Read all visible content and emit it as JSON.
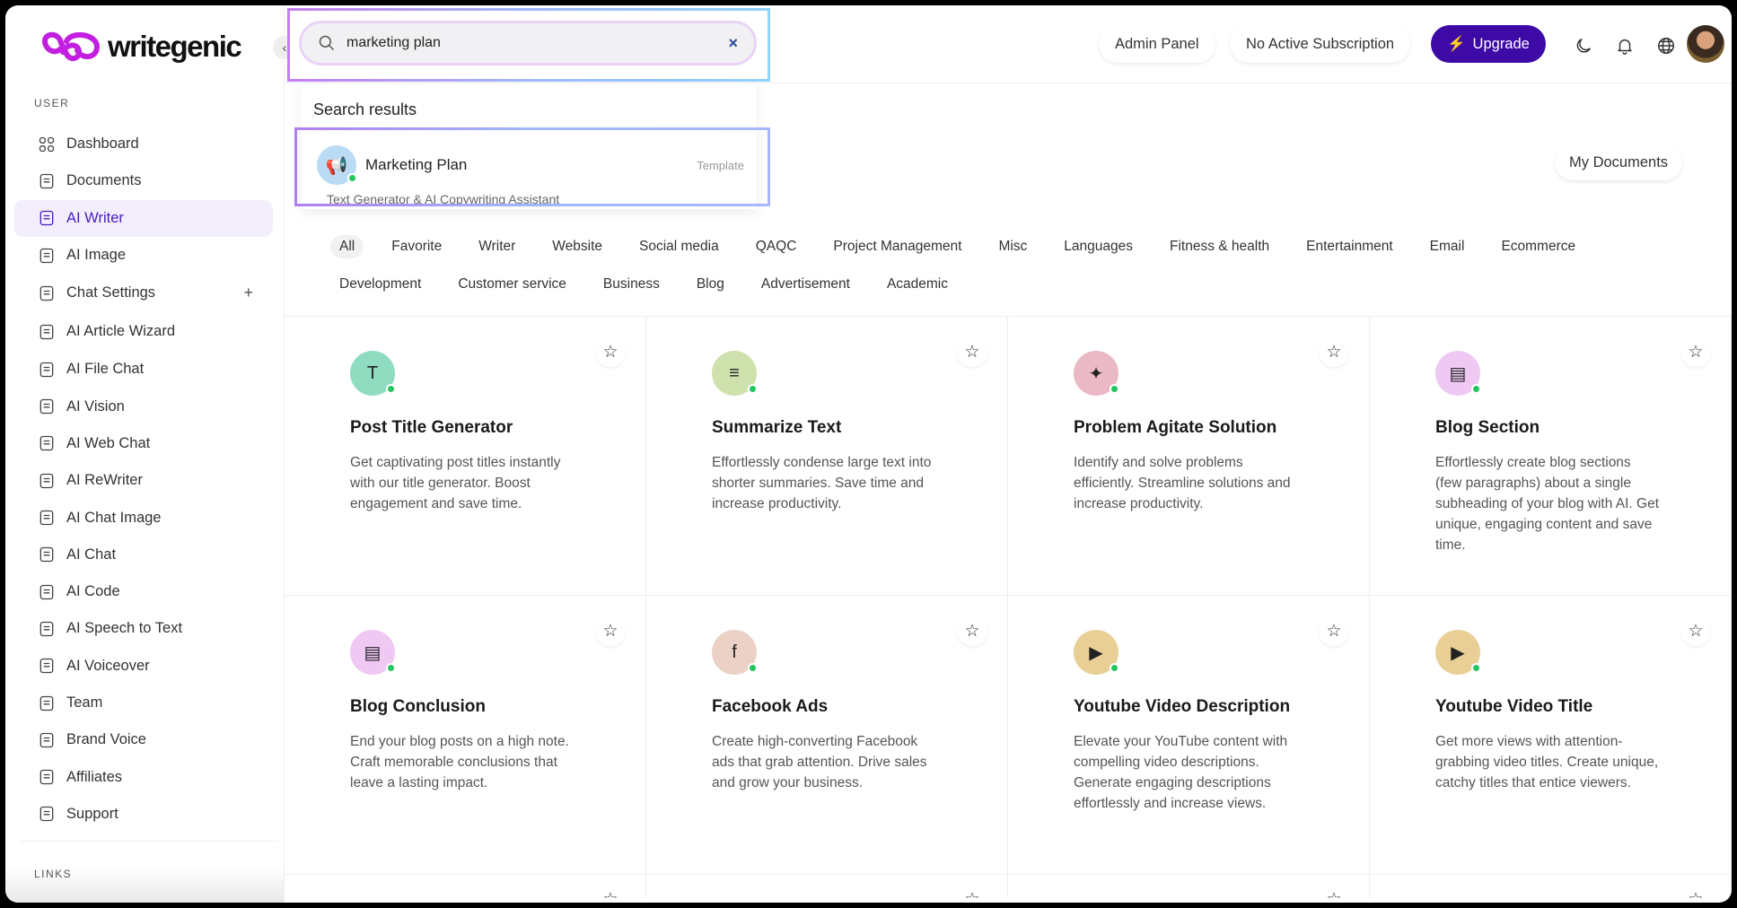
{
  "brand": {
    "name": "writegenic",
    "color": "#c21fe0"
  },
  "sidebar": {
    "section_user": "USER",
    "section_links": "LINKS",
    "active": "AI Writer",
    "items": [
      {
        "label": "Dashboard",
        "icon": "grid-icon"
      },
      {
        "label": "Documents",
        "icon": "archive-icon"
      },
      {
        "label": "AI Writer",
        "icon": "document-icon"
      },
      {
        "label": "AI Image",
        "icon": "image-icon"
      },
      {
        "label": "Chat Settings",
        "icon": "chat-bubble-icon"
      },
      {
        "label": "AI Article Wizard",
        "icon": "article-icon"
      },
      {
        "label": "AI File Chat",
        "icon": "file-icon"
      },
      {
        "label": "AI Vision",
        "icon": "scan-icon"
      },
      {
        "label": "AI Web Chat",
        "icon": "web-icon"
      },
      {
        "label": "AI ReWriter",
        "icon": "pen-icon"
      },
      {
        "label": "AI Chat Image",
        "icon": "image-icon"
      },
      {
        "label": "AI Chat",
        "icon": "chat-icon"
      },
      {
        "label": "AI Code",
        "icon": "terminal-icon"
      },
      {
        "label": "AI Speech to Text",
        "icon": "microphone-icon"
      },
      {
        "label": "AI Voiceover",
        "icon": "speaker-icon"
      },
      {
        "label": "Team",
        "icon": "user-plus-icon"
      },
      {
        "label": "Brand Voice",
        "icon": "brand-icon"
      },
      {
        "label": "Affiliates",
        "icon": "dollar-icon"
      },
      {
        "label": "Support",
        "icon": "lifebuoy-icon"
      }
    ]
  },
  "search": {
    "value": "marketing plan",
    "results_title": "Search results",
    "result": {
      "name": "Marketing Plan",
      "tag": "Template",
      "subtitle": "Text Generator & AI Copywriting Assistant"
    }
  },
  "topbar": {
    "admin_panel": "Admin Panel",
    "subscription": "No Active Subscription",
    "upgrade": "Upgrade",
    "accent": "#3d0aa6"
  },
  "my_documents": "My Documents",
  "filters": [
    "All",
    "Favorite",
    "Writer",
    "Website",
    "Social media",
    "QAQC",
    "Project Management",
    "Misc",
    "Languages",
    "Fitness & health",
    "Entertainment",
    "Email",
    "Ecommerce",
    "Development",
    "Customer service",
    "Business",
    "Blog",
    "Advertisement",
    "Academic"
  ],
  "selected_filter": "All",
  "cards": [
    {
      "title": "Post Title Generator",
      "desc": "Get captivating post titles instantly with our title generator. Boost engagement and save time.",
      "glyph": "T",
      "bg": "#8fdcc0"
    },
    {
      "title": "Summarize Text",
      "desc": "Effortlessly condense large text into shorter summaries. Save time and increase productivity.",
      "glyph": "≡",
      "bg": "#cfe1ad"
    },
    {
      "title": "Problem Agitate Solution",
      "desc": "Identify and solve problems efficiently. Streamline solutions and increase productivity.",
      "glyph": "✦",
      "bg": "#ebb9c6"
    },
    {
      "title": "Blog Section",
      "desc": "Effortlessly create blog sections (few paragraphs) about a single subheading of your blog with AI. Get unique, engaging content and save time.",
      "glyph": "▤",
      "bg": "#efc8f4"
    },
    {
      "title": "Blog Conclusion",
      "desc": "End your blog posts on a high note. Craft memorable conclusions that leave a lasting impact.",
      "glyph": "▤",
      "bg": "#efc8f4"
    },
    {
      "title": "Facebook Ads",
      "desc": "Create high-converting Facebook ads that grab attention. Drive sales and grow your business.",
      "glyph": "f",
      "bg": "#ecd2c6"
    },
    {
      "title": "Youtube Video Description",
      "desc": "Elevate your YouTube content with compelling video descriptions. Generate engaging descriptions effortlessly and increase views.",
      "glyph": "▶",
      "bg": "#e9cf95"
    },
    {
      "title": "Youtube Video Title",
      "desc": "Get more views with attention-grabbing video titles. Create unique, catchy titles that entice viewers.",
      "glyph": "▶",
      "bg": "#e9cf95"
    }
  ]
}
